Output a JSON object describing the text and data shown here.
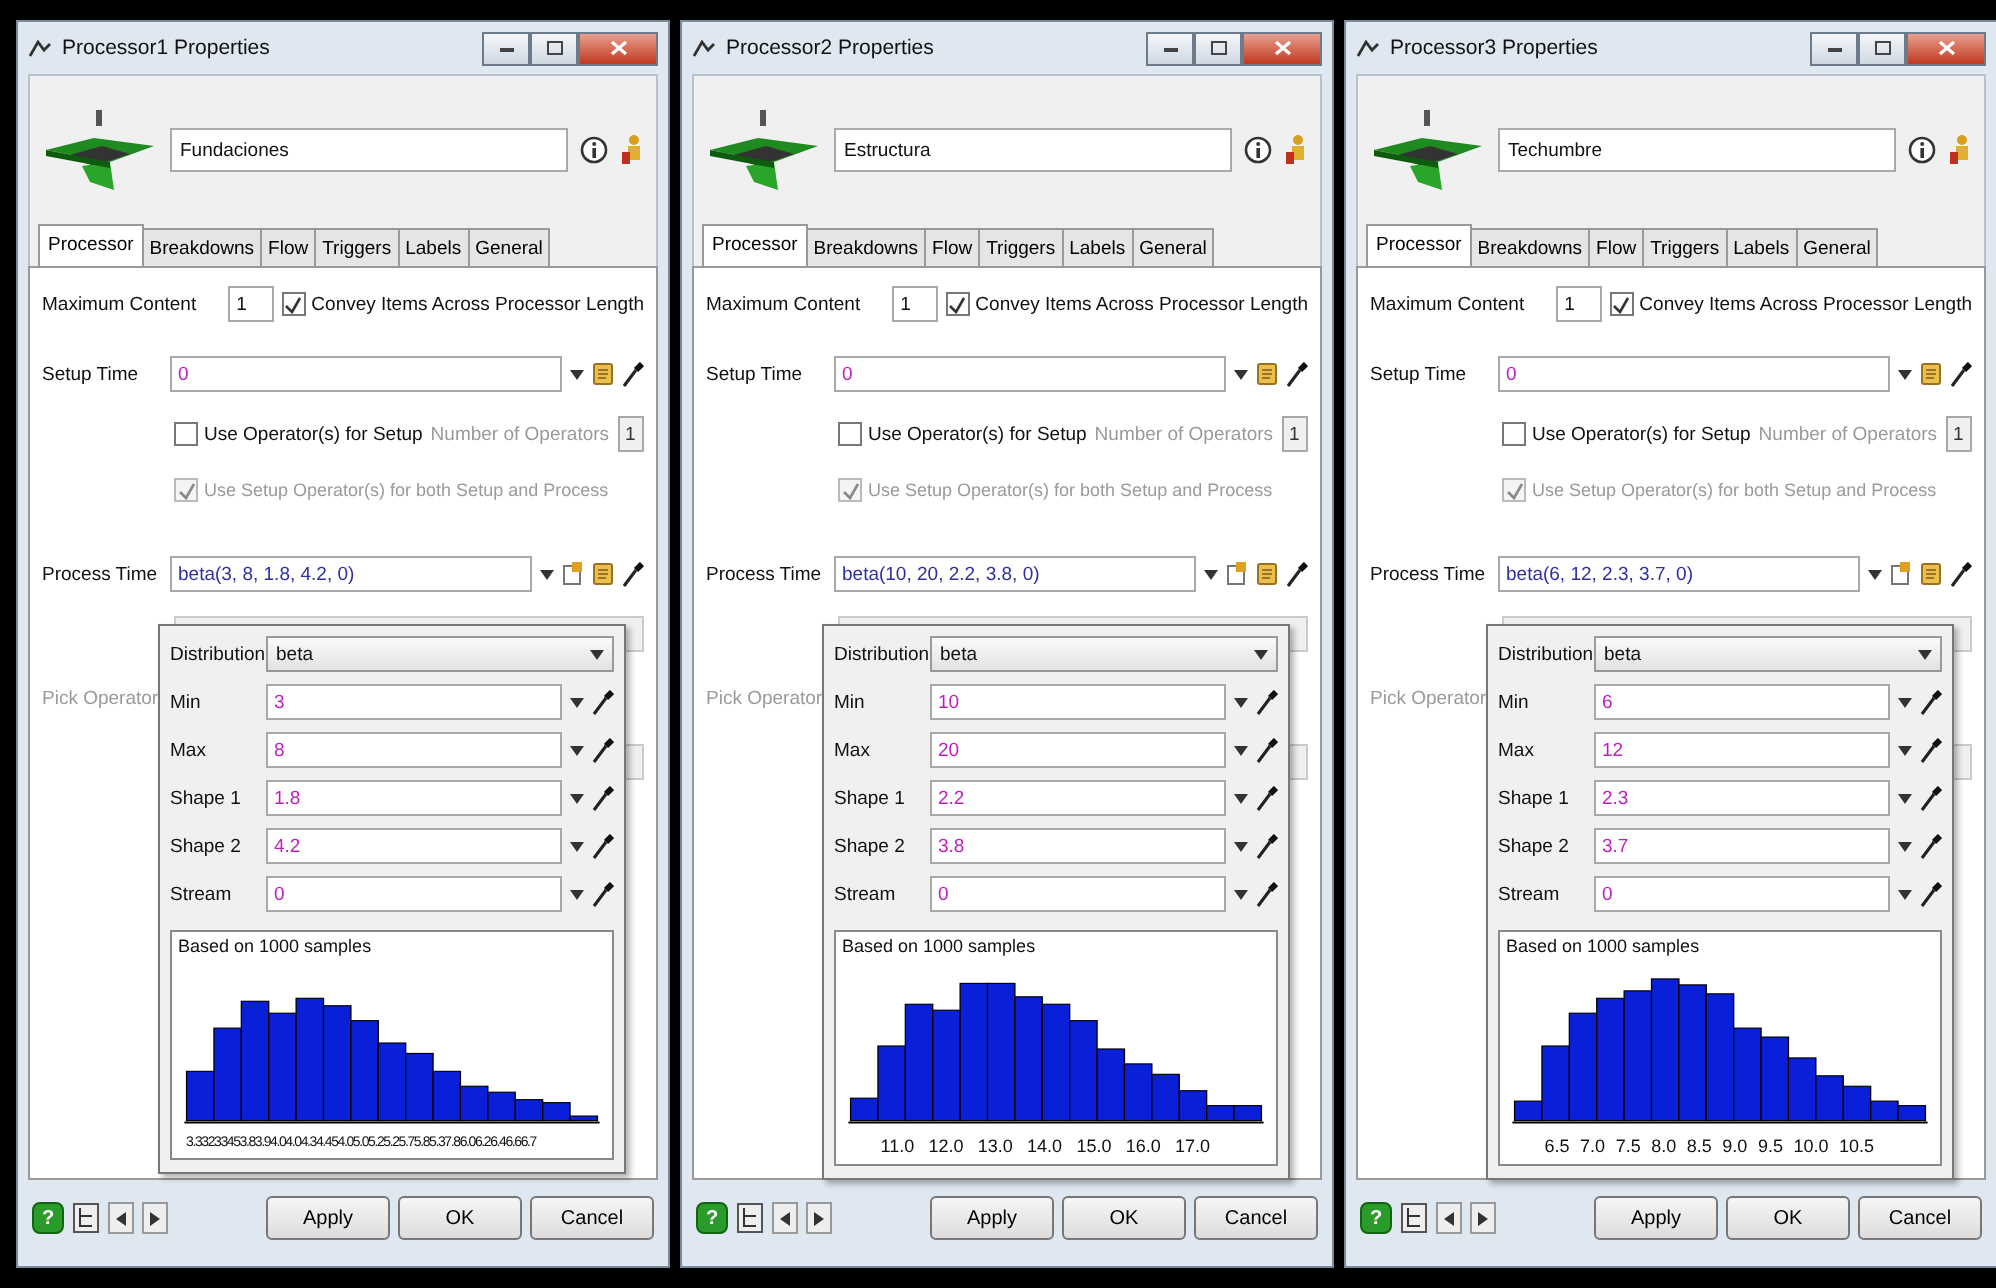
{
  "windows": [
    {
      "title": "Processor1 Properties",
      "name": "Fundaciones",
      "tabs": [
        {
          "label": "Processor",
          "selected": true
        },
        {
          "label": "Breakdowns",
          "selected": false
        },
        {
          "label": "Flow",
          "selected": false
        },
        {
          "label": "Triggers",
          "selected": false
        },
        {
          "label": "Labels",
          "selected": false
        },
        {
          "label": "General",
          "selected": false
        }
      ],
      "max_content": {
        "label": "Maximum Content",
        "value": "1"
      },
      "convey": {
        "label": "Convey Items Across Processor Length",
        "checked": true,
        "disabled": false
      },
      "setup_time": {
        "label": "Setup Time",
        "value": "0"
      },
      "use_operator": {
        "label": "Use Operator(s) for Setup",
        "checked": false,
        "disabled": false
      },
      "num_operators": {
        "label": "Number of Operators",
        "value": "1",
        "disabled": true
      },
      "use_setup_operator": {
        "label": "Use Setup Operator(s) for both Setup and Process",
        "checked": true,
        "disabled": true
      },
      "process_time": {
        "label": "Process Time",
        "value": "beta(3, 8, 1.8, 4.2, 0)"
      },
      "pick_operator": {
        "label": "Pick Operator",
        "disabled": true
      },
      "distribution": {
        "label": "Distribution",
        "value": "beta",
        "params": [
          {
            "label": "Min",
            "value": "3"
          },
          {
            "label": "Max",
            "value": "8"
          },
          {
            "label": "Shape 1",
            "value": "1.8"
          },
          {
            "label": "Shape 2",
            "value": "4.2"
          },
          {
            "label": "Stream",
            "value": "0"
          }
        ]
      },
      "histogram": {
        "caption": "Based on 1000 samples",
        "x_labels": [
          "3.33233453.83.94.04.04.34.454.05.05.25.25.75.85.37.86.06.26.46.66.7"
        ]
      },
      "help": "?",
      "buttons": [
        "Apply",
        "OK",
        "Cancel"
      ]
    },
    {
      "title": "Processor2 Properties",
      "name": "Estructura",
      "tabs": [
        {
          "label": "Processor",
          "selected": true
        },
        {
          "label": "Breakdowns",
          "selected": false
        },
        {
          "label": "Flow",
          "selected": false
        },
        {
          "label": "Triggers",
          "selected": false
        },
        {
          "label": "Labels",
          "selected": false
        },
        {
          "label": "General",
          "selected": false
        }
      ],
      "max_content": {
        "label": "Maximum Content",
        "value": "1"
      },
      "convey": {
        "label": "Convey Items Across Processor Length",
        "checked": true,
        "disabled": false
      },
      "setup_time": {
        "label": "Setup Time",
        "value": "0"
      },
      "use_operator": {
        "label": "Use Operator(s) for Setup",
        "checked": false,
        "disabled": false
      },
      "num_operators": {
        "label": "Number of Operators",
        "value": "1",
        "disabled": true
      },
      "use_setup_operator": {
        "label": "Use Setup Operator(s) for both Setup and Process",
        "checked": true,
        "disabled": true
      },
      "process_time": {
        "label": "Process Time",
        "value": "beta(10, 20, 2.2, 3.8, 0)"
      },
      "pick_operator": {
        "label": "Pick Operator",
        "disabled": true
      },
      "distribution": {
        "label": "Distribution",
        "value": "beta",
        "params": [
          {
            "label": "Min",
            "value": "10"
          },
          {
            "label": "Max",
            "value": "20"
          },
          {
            "label": "Shape 1",
            "value": "2.2"
          },
          {
            "label": "Shape 2",
            "value": "3.8"
          },
          {
            "label": "Stream",
            "value": "0"
          }
        ]
      },
      "histogram": {
        "caption": "Based on 1000 samples",
        "x_labels": [
          "11.0",
          "12.0",
          "13.0",
          "14.0",
          "15.0",
          "16.0",
          "17.0"
        ]
      },
      "help": "?",
      "buttons": [
        "Apply",
        "OK",
        "Cancel"
      ]
    },
    {
      "title": "Processor3 Properties",
      "name": "Techumbre",
      "tabs": [
        {
          "label": "Processor",
          "selected": true
        },
        {
          "label": "Breakdowns",
          "selected": false
        },
        {
          "label": "Flow",
          "selected": false
        },
        {
          "label": "Triggers",
          "selected": false
        },
        {
          "label": "Labels",
          "selected": false
        },
        {
          "label": "General",
          "selected": false
        }
      ],
      "max_content": {
        "label": "Maximum Content",
        "value": "1"
      },
      "convey": {
        "label": "Convey Items Across Processor Length",
        "checked": true,
        "disabled": false
      },
      "setup_time": {
        "label": "Setup Time",
        "value": "0"
      },
      "use_operator": {
        "label": "Use Operator(s) for Setup",
        "checked": false,
        "disabled": false
      },
      "num_operators": {
        "label": "Number of Operators",
        "value": "1",
        "disabled": true
      },
      "use_setup_operator": {
        "label": "Use Setup Operator(s) for both Setup and Process",
        "checked": true,
        "disabled": true
      },
      "process_time": {
        "label": "Process Time",
        "value": "beta(6, 12, 2.3, 3.7, 0)"
      },
      "pick_operator": {
        "label": "Pick Operator",
        "disabled": true
      },
      "distribution": {
        "label": "Distribution",
        "value": "beta",
        "params": [
          {
            "label": "Min",
            "value": "6"
          },
          {
            "label": "Max",
            "value": "12"
          },
          {
            "label": "Shape 1",
            "value": "2.3"
          },
          {
            "label": "Shape 2",
            "value": "3.7"
          },
          {
            "label": "Stream",
            "value": "0"
          }
        ]
      },
      "histogram": {
        "caption": "Based on 1000 samples",
        "x_labels": [
          "6.5",
          "7.0",
          "7.5",
          "8.0",
          "8.5",
          "9.0",
          "9.5",
          "10.0",
          "10.5"
        ]
      },
      "help": "?",
      "buttons": [
        "Apply",
        "OK",
        "Cancel"
      ]
    }
  ]
}
